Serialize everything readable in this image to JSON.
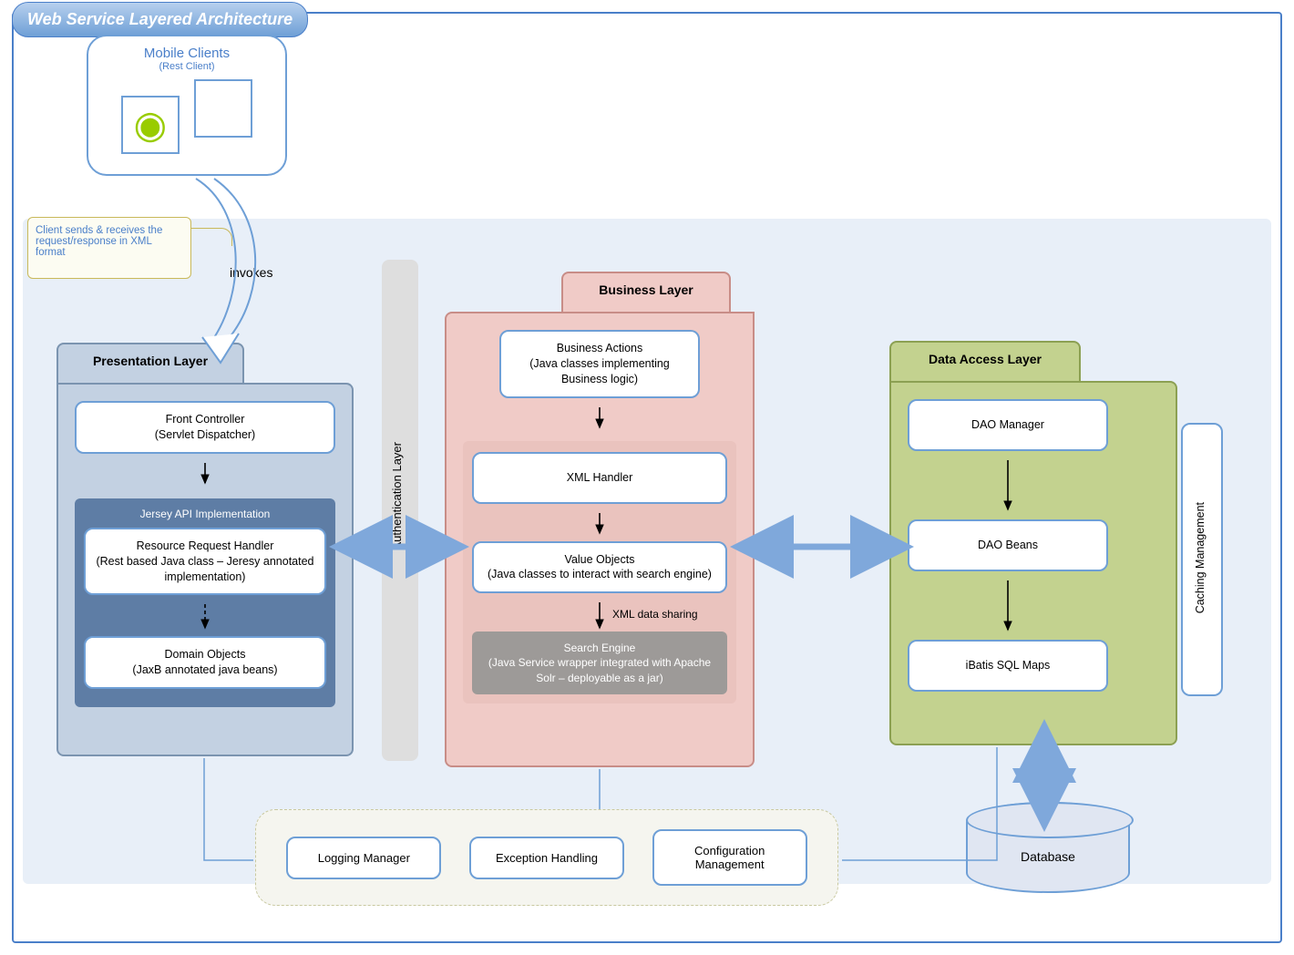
{
  "title": "Web Service Layered Architecture",
  "mobile": {
    "title": "Mobile Clients",
    "sub": "(Rest Client)"
  },
  "note": "Client sends & receives the request/response in XML format",
  "invokes": "invokes",
  "presentation": {
    "tab": "Presentation Layer",
    "front_controller": "Front Controller\n(Servlet Dispatcher)",
    "jersey_title": "Jersey API Implementation",
    "resource_handler": "Resource Request Handler\n(Rest based Java class – Jeresy annotated implementation)",
    "domain_objects": "Domain Objects\n(JaxB annotated java beans)"
  },
  "auth": "Authentication Layer",
  "business": {
    "tab": "Business Layer",
    "actions": "Business Actions\n(Java classes implementing Business logic)",
    "xml_handler": "XML Handler",
    "value_objects": "Value Objects\n(Java classes to interact with search engine)",
    "xml_sharing": "XML data sharing",
    "search_engine": "Search Engine\n(Java Service wrapper integrated with Apache Solr – deployable as a jar)"
  },
  "data_access": {
    "tab": "Data Access Layer",
    "dao_manager": "DAO Manager",
    "dao_beans": "DAO Beans",
    "ibatis": "iBatis SQL Maps",
    "caching": "Caching Management"
  },
  "utility": {
    "logging": "Logging Manager",
    "exception": "Exception Handling",
    "config": "Configuration\nManagement"
  },
  "database": "Database"
}
